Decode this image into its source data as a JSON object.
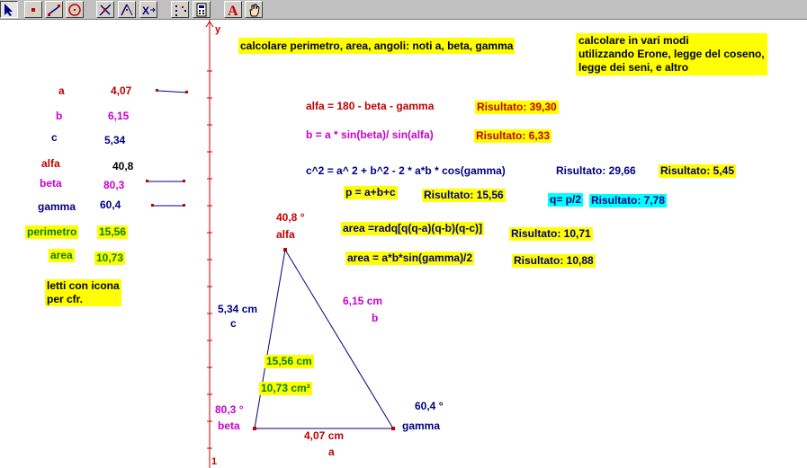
{
  "toolbar": {
    "tools": [
      {
        "name": "arrow-select-tool"
      },
      {
        "name": "point-tool"
      },
      {
        "name": "line-tool"
      },
      {
        "name": "circle-tool"
      },
      {
        "name": "perpendicular-tool"
      },
      {
        "name": "angle-tool"
      },
      {
        "name": "transform-tool"
      },
      {
        "name": "locus-tool"
      },
      {
        "name": "calculator-tool"
      },
      {
        "name": "text-tool"
      },
      {
        "name": "hand-tool"
      }
    ],
    "text_tool_glyph": "A",
    "transform_glyph": "X"
  },
  "axis": {
    "y_label": "y",
    "tick_label": "1"
  },
  "colors": {
    "red": "#c00000",
    "magenta": "#cc00cc",
    "navy": "#000080",
    "green": "#008000",
    "highlight": "#ffff00",
    "cyan": "#00ffff"
  },
  "variables": {
    "a_label": "a",
    "a_value": "4,07",
    "b_label": "b",
    "b_value": "6,15",
    "c_label": "c",
    "c_value": "5,34",
    "alfa_label": "alfa",
    "alfa_value": "40,8",
    "beta_label": "beta",
    "beta_value": "80,3",
    "gamma_label": "gamma",
    "gamma_value": "60,4",
    "perimetro_label": "perimetro",
    "perimetro_value": "15,56",
    "area_label": "area",
    "area_value": "10,73",
    "note": "letti con icona\nper cfr."
  },
  "notes": {
    "task": "calcolare perimetro, area, angoli: noti a, beta, gamma",
    "methods": "calcolare in vari modi\nutilizzando Erone, legge del coseno,\nlegge dei seni, e altro"
  },
  "formulas": {
    "alfa": "alfa = 180 - beta - gamma",
    "alfa_result": "Risultato: 39,30",
    "b": "b = a * sin(beta)/ sin(alfa)",
    "b_result": "Risultato: 6,33",
    "c2": "c^2 = a^ 2 + b^2 - 2 * a*b * cos(gamma)",
    "c2_result": "Risultato: 29,66",
    "c_result": "Risultato: 5,45",
    "p": "p = a+b+c",
    "p_result": "Risultato: 15,56",
    "q": "q= p/2",
    "q_result": "Risultato: 7,78",
    "area_heron": "area =radq[q(q-a)(q-b)(q-c)]",
    "area_heron_result": "Risultato: 10,71",
    "area_sin": "area = a*b*sin(gamma)/2",
    "area_sin_result": "Risultato: 10,88"
  },
  "triangle": {
    "alfa_measure": "40,8  °",
    "alfa_name": "alfa",
    "beta_measure": "80,3  °",
    "beta_name": "beta",
    "gamma_measure": "60,4  °",
    "gamma_name": "gamma",
    "side_c_measure": "5,34  cm",
    "side_c_name": "c",
    "side_b_measure": "6,15  cm",
    "side_b_name": "b",
    "side_a_measure": "4,07  cm",
    "side_a_name": "a",
    "perimeter_measure": "15,56  cm",
    "area_measure": "10,73  cm²"
  }
}
